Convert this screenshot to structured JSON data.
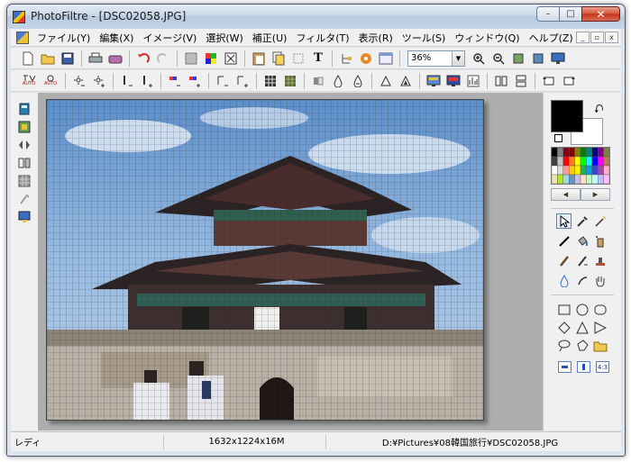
{
  "window": {
    "title": "PhotoFiltre - [DSC02058.JPG]",
    "minimize_glyph": "–",
    "maximize_glyph": "□",
    "close_glyph": "✕"
  },
  "menu": {
    "items": [
      {
        "label": "ファイル(Y)"
      },
      {
        "label": "編集(X)"
      },
      {
        "label": "イメージ(V)"
      },
      {
        "label": "選択(W)"
      },
      {
        "label": "補正(U)"
      },
      {
        "label": "フィルタ(T)"
      },
      {
        "label": "表示(R)"
      },
      {
        "label": "ツール(S)"
      },
      {
        "label": "ウィンドウ(Q)"
      },
      {
        "label": "ヘルプ(Z)"
      }
    ],
    "mdi_minimize": "_",
    "mdi_restore": "▫",
    "mdi_close": "x"
  },
  "toolbar1": {
    "icons": [
      "new-icon",
      "open-icon",
      "save-icon",
      "print-icon",
      "scan-icon",
      "undo-icon",
      "redo-icon",
      "transparency-icon",
      "color-icon",
      "frame-icon",
      "paste-icon",
      "copy-icon",
      "crop-icon",
      "text-icon",
      "image-tree-icon",
      "plugin-icon",
      "browser-icon"
    ],
    "text_tool_glyph": "T",
    "zoom_value": "36%",
    "zoom_icons": [
      "zoom-in-icon",
      "zoom-out-icon",
      "fit-image-icon",
      "actual-size-icon",
      "full-screen-icon"
    ]
  },
  "toolbar2": {
    "auto_label": "AUTO"
  },
  "status": {
    "state": "レディ",
    "image_info": "1632x1224x16M",
    "path": "D:¥Pictures¥08韓国旅行¥DSC02058.JPG"
  },
  "colors": {
    "foreground": "#000000",
    "background": "#ffffff",
    "window_frame": "#dce4ee",
    "workspace": "#aeaeae"
  },
  "palette": [
    "#000000",
    "#7f7f7f",
    "#880015",
    "#7f0000",
    "#7f7f00",
    "#007f00",
    "#007f7f",
    "#00007f",
    "#7f007f",
    "#7f7f3f",
    "#3f3f3f",
    "#c3c3c3",
    "#ff0000",
    "#ff7f27",
    "#ffff00",
    "#00ff00",
    "#00ffff",
    "#0000ff",
    "#ff00ff",
    "#b97a57",
    "#ffffff",
    "#dddddd",
    "#ff9999",
    "#ffc90e",
    "#fff200",
    "#22b14c",
    "#00a2e8",
    "#3f48cc",
    "#a349a4",
    "#ffaec9",
    "#efe4b0",
    "#b5e61d",
    "#99d9ea",
    "#7092be",
    "#c8bfe7",
    "#ffe0c0",
    "#c0ffc0",
    "#c0ffff",
    "#c0c0ff",
    "#ffc0ff"
  ],
  "mode_buttons": [
    "4:3"
  ]
}
